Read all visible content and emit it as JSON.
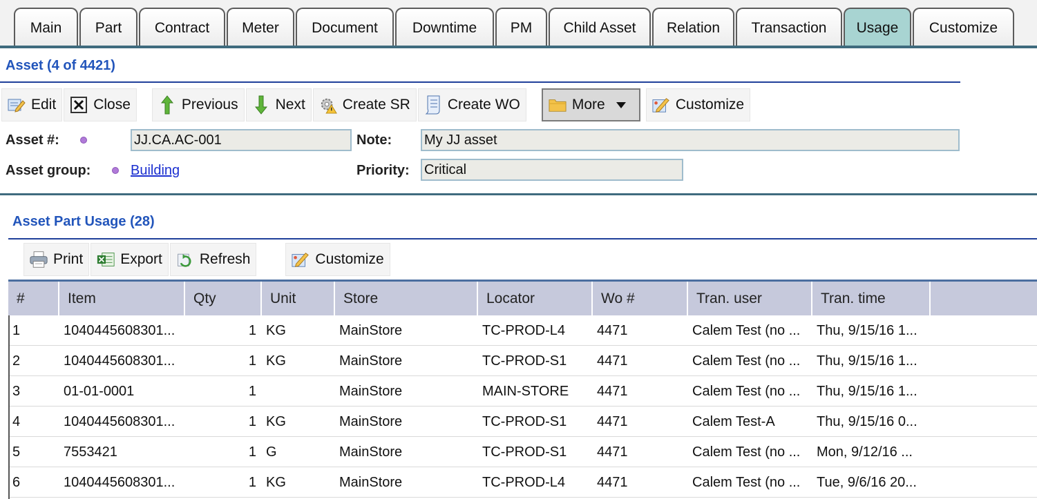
{
  "tabs": [
    {
      "label": "Main",
      "active": false
    },
    {
      "label": "Part",
      "active": false
    },
    {
      "label": "Contract",
      "active": false
    },
    {
      "label": "Meter",
      "active": false
    },
    {
      "label": "Document",
      "active": false
    },
    {
      "label": "Downtime",
      "active": false
    },
    {
      "label": "PM",
      "active": false
    },
    {
      "label": "Child Asset",
      "active": false
    },
    {
      "label": "Relation",
      "active": false
    },
    {
      "label": "Transaction",
      "active": false
    },
    {
      "label": "Usage",
      "active": true
    },
    {
      "label": "Customize",
      "active": false
    }
  ],
  "header": {
    "title": "Asset (4 of 4421)"
  },
  "toolbar": {
    "edit": "Edit",
    "close": "Close",
    "previous": "Previous",
    "next": "Next",
    "create_sr": "Create SR",
    "create_wo": "Create WO",
    "more": "More",
    "customize": "Customize"
  },
  "form": {
    "asset_no_label": "Asset #:",
    "asset_no_value": "JJ.CA.AC-001",
    "note_label": "Note:",
    "note_value": "My JJ asset",
    "asset_group_label": "Asset group:",
    "asset_group_value": "Building",
    "priority_label": "Priority:",
    "priority_value": "Critical"
  },
  "usage": {
    "title": "Asset Part Usage (28)",
    "toolbar": {
      "print": "Print",
      "export": "Export",
      "refresh": "Refresh",
      "customize": "Customize"
    },
    "columns": [
      "#",
      "Item",
      "Qty",
      "Unit",
      "Store",
      "Locator",
      "Wo #",
      "Tran. user",
      "Tran. time"
    ],
    "rows": [
      [
        "1",
        "1040445608301...",
        "1",
        "KG",
        "MainStore",
        "TC-PROD-L4",
        "4471",
        "Calem Test (no ...",
        "Thu, 9/15/16 1..."
      ],
      [
        "2",
        "1040445608301...",
        "1",
        "KG",
        "MainStore",
        "TC-PROD-S1",
        "4471",
        "Calem Test (no ...",
        "Thu, 9/15/16 1..."
      ],
      [
        "3",
        "01-01-0001",
        "1",
        "",
        "MainStore",
        "MAIN-STORE",
        "4471",
        "Calem Test (no ...",
        "Thu, 9/15/16 1..."
      ],
      [
        "4",
        "1040445608301...",
        "1",
        "KG",
        "MainStore",
        "TC-PROD-S1",
        "4471",
        "Calem Test-A",
        "Thu, 9/15/16 0..."
      ],
      [
        "5",
        "7553421",
        "1",
        "G",
        "MainStore",
        "TC-PROD-S1",
        "4471",
        "Calem Test (no ...",
        "Mon, 9/12/16 ..."
      ],
      [
        "6",
        "1040445608301...",
        "1",
        "KG",
        "MainStore",
        "TC-PROD-L4",
        "4471",
        "Calem Test (no ...",
        "Tue, 9/6/16 20..."
      ]
    ]
  },
  "colors": {
    "accent": "#2255bb",
    "active_tab": "#a8d4d2",
    "header_bg": "#c6c9dc",
    "link": "#1b2fd0"
  },
  "icons": {
    "edit": "edit-icon",
    "close": "close-icon",
    "previous": "arrow-up-icon",
    "next": "arrow-down-icon",
    "create_sr": "gear-warning-icon",
    "create_wo": "document-icon",
    "more": "folder-icon",
    "customize": "customize-icon",
    "print": "printer-icon",
    "export": "excel-icon",
    "refresh": "refresh-icon"
  }
}
